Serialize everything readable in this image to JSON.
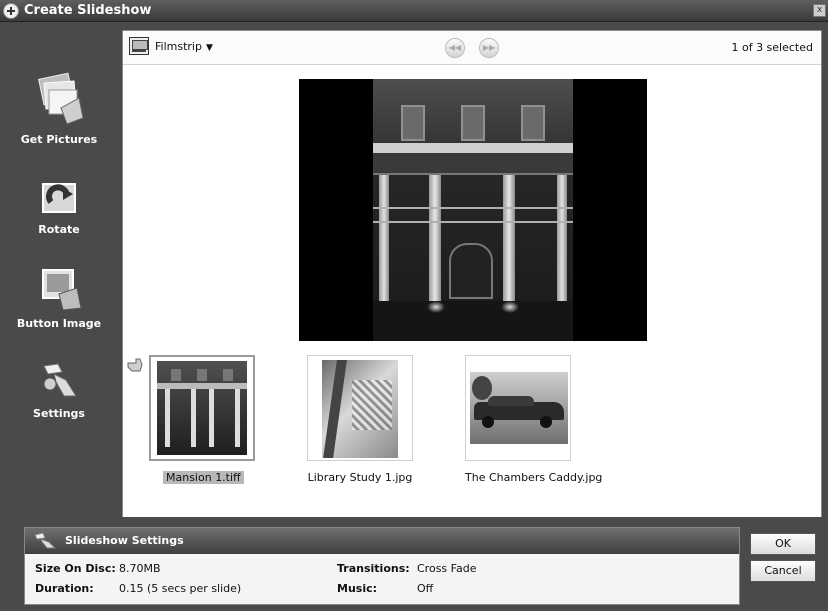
{
  "window": {
    "title": "Create Slideshow",
    "close_label": "x"
  },
  "tools": [
    {
      "label": "Get Pictures",
      "icon": "get-pictures-icon"
    },
    {
      "label": "Rotate",
      "icon": "rotate-icon"
    },
    {
      "label": "Button Image",
      "icon": "button-image-icon"
    },
    {
      "label": "Settings",
      "icon": "settings-icon"
    }
  ],
  "toolbar": {
    "view_label": "Filmstrip",
    "prev_label": "◀◀",
    "next_label": "▶▶",
    "selection_status": "1 of 3 selected"
  },
  "filmstrip": [
    {
      "caption": "Mansion 1.tiff",
      "selected": true
    },
    {
      "caption": "Library Study 1.jpg",
      "selected": false
    },
    {
      "caption": "The Chambers Caddy.jpg",
      "selected": false
    }
  ],
  "settings": {
    "header": "Slideshow Settings",
    "size_label": "Size On Disc:",
    "size_value": "8.70MB",
    "duration_label": "Duration:",
    "duration_value": "0.15 (5 secs per slide)",
    "transitions_label": "Transitions:",
    "transitions_value": "Cross Fade",
    "music_label": "Music:",
    "music_value": "Off"
  },
  "buttons": {
    "ok": "OK",
    "cancel": "Cancel"
  }
}
